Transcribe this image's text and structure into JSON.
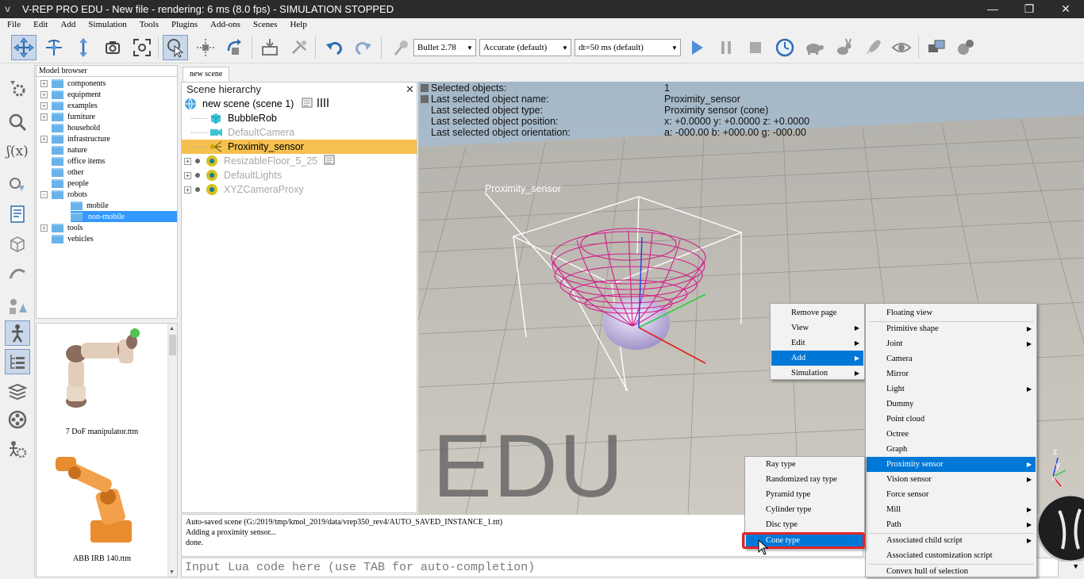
{
  "window": {
    "title": "V-REP PRO EDU - New file - rendering: 6 ms (8.0 fps) - SIMULATION STOPPED",
    "controls": [
      "—",
      "❐",
      "✕"
    ]
  },
  "menubar": [
    "File",
    "Edit",
    "Add",
    "Simulation",
    "Tools",
    "Plugins",
    "Add-ons",
    "Scenes",
    "Help"
  ],
  "toolbar": {
    "engine": "Bullet 2.78",
    "accuracy": "Accurate (default)",
    "timestep": "dt=50 ms (default)"
  },
  "model_browser": {
    "header": "Model browser",
    "items": [
      {
        "label": "components",
        "expandable": true
      },
      {
        "label": "equipment",
        "expandable": true
      },
      {
        "label": "examples",
        "expandable": true
      },
      {
        "label": "furniture",
        "expandable": true
      },
      {
        "label": "household",
        "expandable": false
      },
      {
        "label": "infrastructure",
        "expandable": true
      },
      {
        "label": "nature",
        "expandable": false
      },
      {
        "label": "office items",
        "expandable": false
      },
      {
        "label": "other",
        "expandable": false
      },
      {
        "label": "people",
        "expandable": false
      },
      {
        "label": "robots",
        "expandable": true
      },
      {
        "label": "mobile",
        "expandable": false
      },
      {
        "label": "non-mobile",
        "expandable": false
      },
      {
        "label": "tools",
        "expandable": true
      },
      {
        "label": "vehicles",
        "expandable": false
      }
    ],
    "thumbnails": [
      "7 DoF manipulator.ttm",
      "ABB IRB 140.ttm"
    ]
  },
  "tab": "new scene",
  "scene_hierarchy": {
    "title": "Scene hierarchy",
    "root": "new scene (scene 1)",
    "objects": [
      "BubbleRob",
      "DefaultCamera",
      "Proximity_sensor",
      "ResizableFloor_5_25",
      "DefaultLights",
      "XYZCameraProxy"
    ]
  },
  "viewport": {
    "info_labels": [
      "Selected objects:",
      "Last selected object name:",
      "Last selected object type:",
      "Last selected object position:",
      "Last selected object orientation:"
    ],
    "info_values": [
      "1",
      "Proximity_sensor",
      "Proximity sensor (cone)",
      "x: +0.0000    y: +0.0000    z: +0.0000",
      "a: -000.00    b: +000.00    g: -000.00"
    ],
    "sensor_label": "Proximity_sensor",
    "watermark": "EDU",
    "axes": [
      "z",
      "y",
      "x"
    ]
  },
  "console": [
    "Auto-saved scene (G:/2019/tmp/kmol_2019/data/vrep350_rev4/AUTO_SAVED_INSTANCE_1.ttt)",
    "Adding a proximity sensor...",
    "done."
  ],
  "lua_placeholder": "Input Lua code here (use TAB for auto-completion)",
  "context_menu": [
    "Remove page",
    "View",
    "Edit",
    "Add",
    "Simulation"
  ],
  "add_menu": [
    "Floating view",
    "Primitive shape",
    "Joint",
    "Camera",
    "Mirror",
    "Light",
    "Dummy",
    "Point cloud",
    "Octree",
    "Graph",
    "Proximity sensor",
    "Vision sensor",
    "Force sensor",
    "Mill",
    "Path",
    "Associated child script",
    "Associated customization script",
    "Convex hull of selection"
  ],
  "proximity_menu": [
    "Ray type",
    "Randomized ray type",
    "Pyramid type",
    "Cylinder type",
    "Disc type",
    "Cone type"
  ],
  "colors": {
    "selection": "#f5c04f",
    "menu_highlight": "#0078d7",
    "sensor": "#d21e8c",
    "callout": "#e32226"
  }
}
